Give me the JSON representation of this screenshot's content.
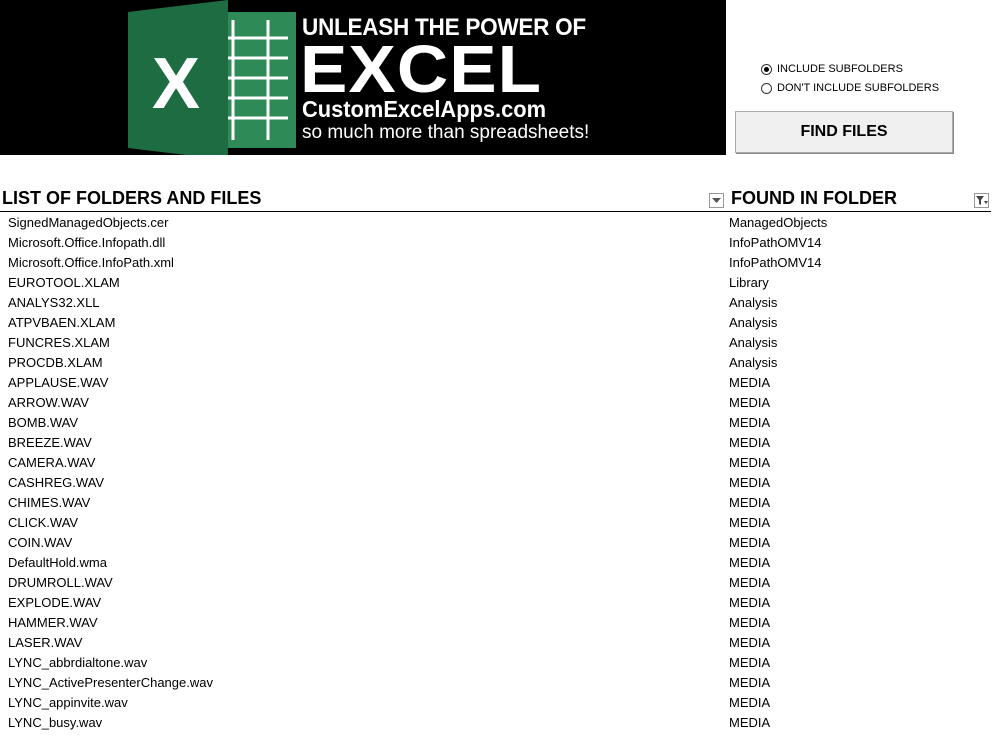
{
  "banner": {
    "line1": "UNLEASH THE POWER OF",
    "line2": "EXCEL",
    "line3": "CustomExcelApps.com",
    "line4": "so much more than spreadsheets!",
    "logo_letter": "X"
  },
  "options": {
    "include_subfolders": "INCLUDE SUBFOLDERS",
    "dont_include_subfolders": "DON'T INCLUDE SUBFOLDERS",
    "selected": "include_subfolders",
    "find_files": "FIND FILES"
  },
  "table": {
    "col1_header": "LIST OF FOLDERS AND FILES",
    "col2_header": "FOUND IN FOLDER",
    "rows": [
      [
        "SignedManagedObjects.cer",
        "ManagedObjects"
      ],
      [
        "Microsoft.Office.Infopath.dll",
        "InfoPathOMV14"
      ],
      [
        "Microsoft.Office.InfoPath.xml",
        "InfoPathOMV14"
      ],
      [
        "EUROTOOL.XLAM",
        "Library"
      ],
      [
        "ANALYS32.XLL",
        "Analysis"
      ],
      [
        "ATPVBAEN.XLAM",
        "Analysis"
      ],
      [
        "FUNCRES.XLAM",
        "Analysis"
      ],
      [
        "PROCDB.XLAM",
        "Analysis"
      ],
      [
        "APPLAUSE.WAV",
        "MEDIA"
      ],
      [
        "ARROW.WAV",
        "MEDIA"
      ],
      [
        "BOMB.WAV",
        "MEDIA"
      ],
      [
        "BREEZE.WAV",
        "MEDIA"
      ],
      [
        "CAMERA.WAV",
        "MEDIA"
      ],
      [
        "CASHREG.WAV",
        "MEDIA"
      ],
      [
        "CHIMES.WAV",
        "MEDIA"
      ],
      [
        "CLICK.WAV",
        "MEDIA"
      ],
      [
        "COIN.WAV",
        "MEDIA"
      ],
      [
        "DefaultHold.wma",
        "MEDIA"
      ],
      [
        "DRUMROLL.WAV",
        "MEDIA"
      ],
      [
        "EXPLODE.WAV",
        "MEDIA"
      ],
      [
        "HAMMER.WAV",
        "MEDIA"
      ],
      [
        "LASER.WAV",
        "MEDIA"
      ],
      [
        "LYNC_abbrdialtone.wav",
        "MEDIA"
      ],
      [
        "LYNC_ActivePresenterChange.wav",
        "MEDIA"
      ],
      [
        "LYNC_appinvite.wav",
        "MEDIA"
      ],
      [
        "LYNC_busy.wav",
        "MEDIA"
      ]
    ]
  },
  "colors": {
    "banner_bg": "#000000",
    "excel_green": "#217346",
    "excel_green_dark": "#185c37"
  }
}
